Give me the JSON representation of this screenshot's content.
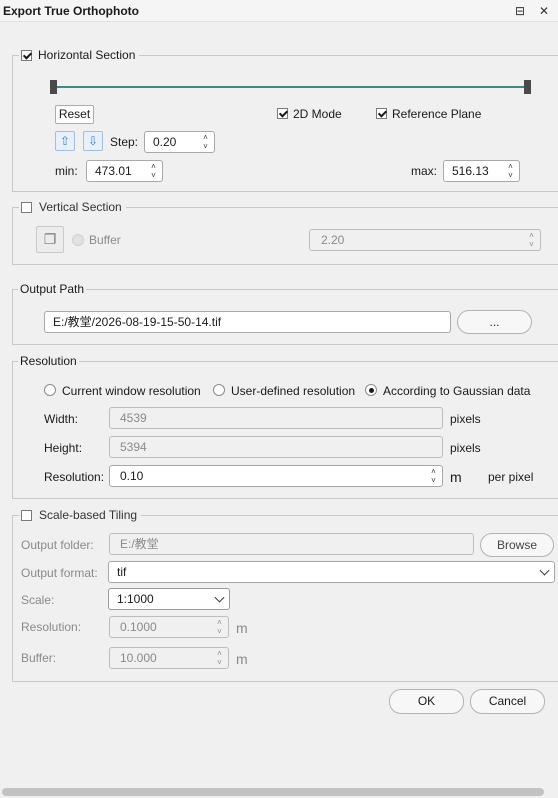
{
  "window": {
    "title": "Export True Orthophoto"
  },
  "horizontal": {
    "legend": "Horizontal Section",
    "checked": true,
    "reset_label": "Reset",
    "mode_2d_label": "2D Mode",
    "reference_plane_label": "Reference Plane",
    "step_label": "Step:",
    "step_value": "0.20",
    "min_label": "min:",
    "min_value": "473.01",
    "max_label": "max:",
    "max_value": "516.13"
  },
  "vertical": {
    "legend": "Vertical Section",
    "checked": false,
    "buffer_label": "Buffer",
    "buffer_value": "2.20"
  },
  "output_path": {
    "legend": "Output Path",
    "value": "E:/教堂/2026-08-19-15-50-14.tif",
    "browse_label": "..."
  },
  "resolution": {
    "legend": "Resolution",
    "options": [
      "Current window resolution",
      "User-defined resolution",
      "According to Gaussian data"
    ],
    "selected": "According to Gaussian data",
    "width_label": "Width:",
    "width_value": "4539",
    "height_label": "Height:",
    "height_value": "5394",
    "resolution_label": "Resolution:",
    "resolution_value": "0.10",
    "pixels_label": "pixels",
    "unit": "m",
    "per_pixel_label": "per pixel"
  },
  "tiling": {
    "legend": "Scale-based Tiling",
    "checked": false,
    "folder_label": "Output folder:",
    "folder_value": "E:/教堂",
    "browse_label": "Browse",
    "format_label": "Output format:",
    "format_value": "tif",
    "scale_label": "Scale:",
    "scale_value": "1:1000",
    "resolution_label": "Resolution:",
    "resolution_value": "0.1000",
    "buffer_label": "Buffer:",
    "buffer_value": "10.000",
    "unit": "m"
  },
  "footer": {
    "ok_label": "OK",
    "cancel_label": "Cancel"
  }
}
